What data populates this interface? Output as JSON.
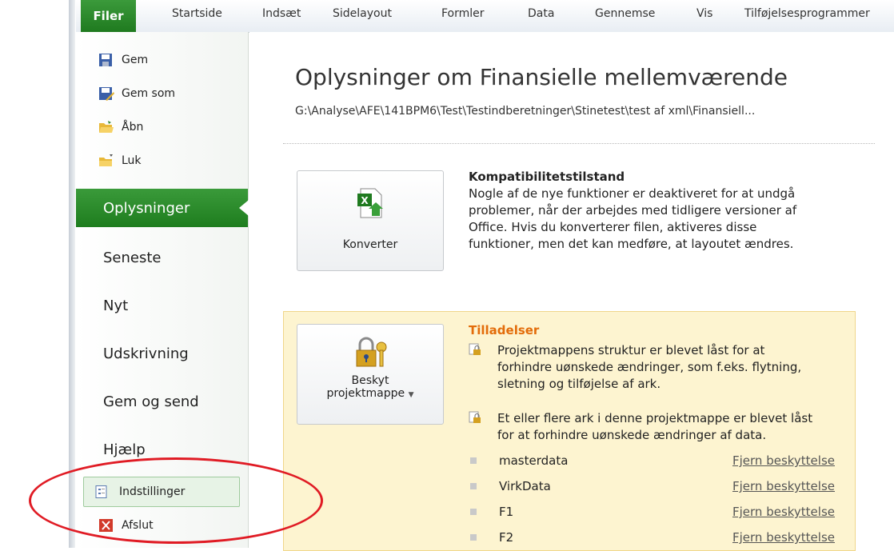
{
  "ribbon": {
    "file_tab": "Filer",
    "tabs": [
      "Startside",
      "Indsæt",
      "Sidelayout",
      "Formler",
      "Data",
      "Gennemse",
      "Vis",
      "Tilføjelsesprogrammer"
    ]
  },
  "backstage": {
    "commands": [
      {
        "label": "Gem",
        "icon": "save-icon"
      },
      {
        "label": "Gem som",
        "icon": "save-as-icon"
      },
      {
        "label": "Åbn",
        "icon": "open-folder-icon"
      },
      {
        "label": "Luk",
        "icon": "close-folder-icon"
      }
    ],
    "nav": [
      "Oplysninger",
      "Seneste",
      "Nyt",
      "Udskrivning",
      "Gem og send",
      "Hjælp"
    ],
    "active_nav": "Oplysninger",
    "settings_label": "Indstillinger",
    "exit_label": "Afslut"
  },
  "info": {
    "title": "Oplysninger om Finansielle mellemværende",
    "path": "G:\\Analyse\\AFE\\141BPM6\\Test\\Testindberetninger\\Stinetest\\test af xml\\Finansiell...",
    "compat": {
      "button_label": "Konverter",
      "title": "Kompatibilitetstilstand",
      "lines": [
        "Nogle af de nye funktioner er deaktiveret for at undgå",
        "problemer, når der arbejdes med tidligere versioner af",
        "Office. Hvis du konverterer filen, aktiveres disse",
        "funktioner, men det kan medføre, at layoutet ændres."
      ]
    },
    "permissions": {
      "button_line1": "Beskyt",
      "button_line2": "projektmappe",
      "title": "Tilladelser",
      "note1": [
        "Projektmappens struktur er blevet låst for at",
        "forhindre uønskede ændringer, som f.eks. flytning,",
        "sletning og tilføjelse af ark."
      ],
      "note2": [
        "Et eller flere ark i denne projektmappe er blevet låst",
        "for at forhindre uønskede ændringer af data."
      ],
      "sheets": [
        "masterdata",
        "VirkData",
        "F1",
        "F2"
      ],
      "unprotect_label": "Fjern beskyttelse"
    }
  },
  "colors": {
    "accent_green": "#1f7a1f",
    "permissions_title": "#e36c0a",
    "permissions_bg": "#fdf4d0",
    "annotation_red": "#e01b24"
  }
}
